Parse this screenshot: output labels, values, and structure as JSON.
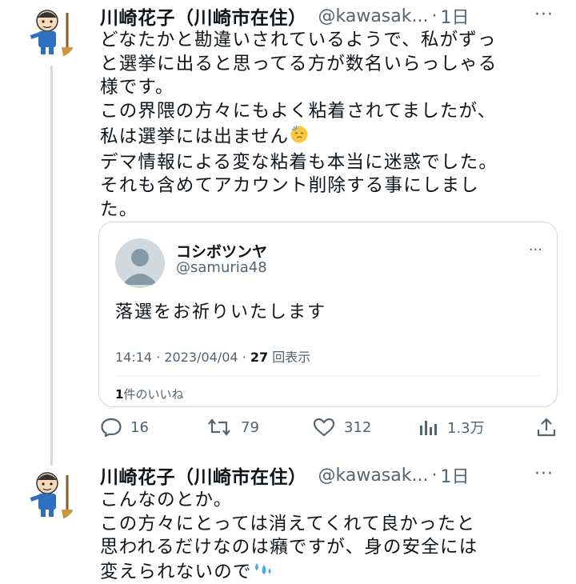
{
  "tweets": [
    {
      "author_name": "川崎花子（川崎市在住）",
      "handle": "@kawasak...",
      "separator": "·",
      "time": "1日",
      "more": "···",
      "lines": [
        "どなたかと勘違いされているようで、私がずっ",
        "と選挙に出ると思ってる方が数名いらっしゃる",
        "様です。",
        "この界隈の方々にもよく粘着されてましたが、",
        "私は選挙には出ません",
        "デマ情報による変な粘着も本当に迷惑でした。",
        "それも含めてアカウント削除する事にしまし",
        "た。"
      ],
      "emoji_name": "relieved-sweat-emoji",
      "quote": {
        "name": "コシボツンヤ",
        "handle": "@samuria48",
        "more": "···",
        "text": "落選をお祈りいたします",
        "time": "14:14",
        "date": "2023/04/04",
        "views_count": "27",
        "views_label": "回表示",
        "likes_count": "1",
        "likes_label": "件のいいね"
      },
      "actions": {
        "replies": "16",
        "retweets": "79",
        "likes": "312",
        "views": "1.3万"
      }
    },
    {
      "author_name": "川崎花子（川崎市在住）",
      "handle": "@kawasak...",
      "separator": "·",
      "time": "1日",
      "more": "···",
      "lines": [
        "こんなのとか。",
        "この方々にとっては消えてくれて良かったと",
        "思われるだけなのは癪ですが、身の安全には",
        "変えられないので"
      ],
      "emoji_name": "sweat-droplets-emoji"
    }
  ],
  "colors": {
    "text": "#0f1419",
    "muted": "#536471",
    "border": "#cfd9de",
    "avatar_shirt": "#2f6fbf"
  }
}
